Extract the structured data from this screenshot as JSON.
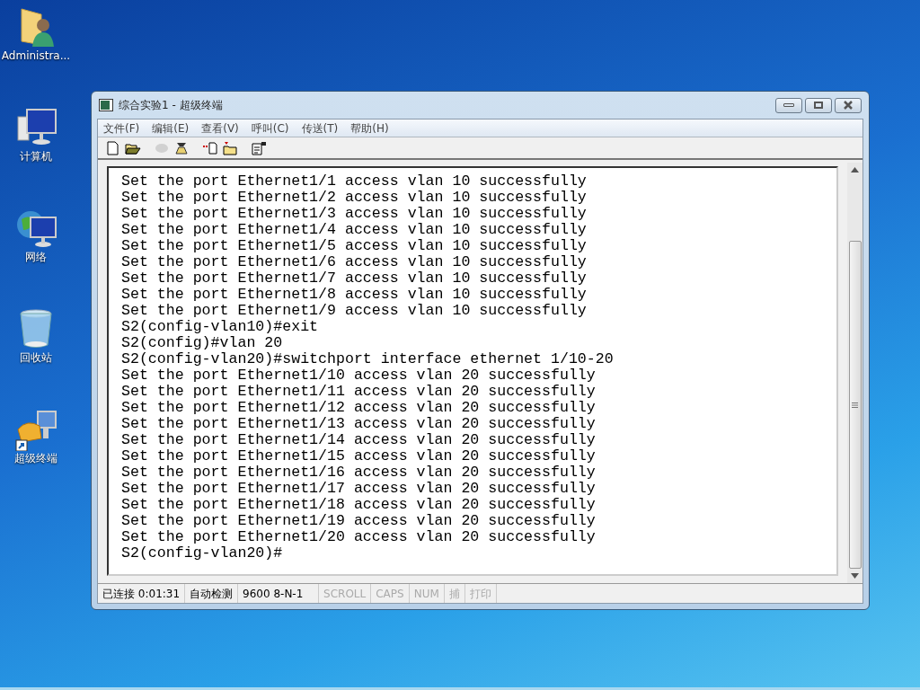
{
  "desktop_icons": [
    {
      "label": "Administra...",
      "kind": "folder"
    },
    {
      "label": "计算机",
      "kind": "computer"
    },
    {
      "label": "网络",
      "kind": "network"
    },
    {
      "label": "回收站",
      "kind": "recycle"
    },
    {
      "label": "超级终端",
      "kind": "terminal"
    }
  ],
  "window": {
    "title": "综合实验1 - 超级终端"
  },
  "menu": [
    "文件(F)",
    "编辑(E)",
    "查看(V)",
    "呼叫(C)",
    "传送(T)",
    "帮助(H)"
  ],
  "toolbar": [
    {
      "kind": "new",
      "disabled": false
    },
    {
      "kind": "open",
      "disabled": false
    },
    {
      "kind": "disconnect",
      "disabled": true
    },
    {
      "kind": "call",
      "disabled": false
    },
    {
      "kind": "send",
      "disabled": false
    },
    {
      "kind": "receive",
      "disabled": false
    },
    {
      "kind": "properties",
      "disabled": false
    }
  ],
  "terminal_lines": [
    "Set the port Ethernet1/1 access vlan 10 successfully",
    "Set the port Ethernet1/2 access vlan 10 successfully",
    "Set the port Ethernet1/3 access vlan 10 successfully",
    "Set the port Ethernet1/4 access vlan 10 successfully",
    "Set the port Ethernet1/5 access vlan 10 successfully",
    "Set the port Ethernet1/6 access vlan 10 successfully",
    "Set the port Ethernet1/7 access vlan 10 successfully",
    "Set the port Ethernet1/8 access vlan 10 successfully",
    "Set the port Ethernet1/9 access vlan 10 successfully",
    "S2(config-vlan10)#exit",
    "S2(config)#vlan 20",
    "S2(config-vlan20)#switchport interface ethernet 1/10-20",
    "Set the port Ethernet1/10 access vlan 20 successfully",
    "Set the port Ethernet1/11 access vlan 20 successfully",
    "Set the port Ethernet1/12 access vlan 20 successfully",
    "Set the port Ethernet1/13 access vlan 20 successfully",
    "Set the port Ethernet1/14 access vlan 20 successfully",
    "Set the port Ethernet1/15 access vlan 20 successfully",
    "Set the port Ethernet1/16 access vlan 20 successfully",
    "Set the port Ethernet1/17 access vlan 20 successfully",
    "Set the port Ethernet1/18 access vlan 20 successfully",
    "Set the port Ethernet1/19 access vlan 20 successfully",
    "Set the port Ethernet1/20 access vlan 20 successfully",
    "S2(config-vlan20)#"
  ],
  "status_bar": [
    {
      "text": "已连接 0:01:31",
      "disabled": false
    },
    {
      "text": "自动检测",
      "disabled": false
    },
    {
      "text": "9600 8-N-1",
      "disabled": false
    },
    {
      "text": "SCROLL",
      "disabled": true
    },
    {
      "text": "CAPS",
      "disabled": true
    },
    {
      "text": "NUM",
      "disabled": true
    },
    {
      "text": "捕",
      "disabled": true
    },
    {
      "text": "打印",
      "disabled": true
    }
  ]
}
